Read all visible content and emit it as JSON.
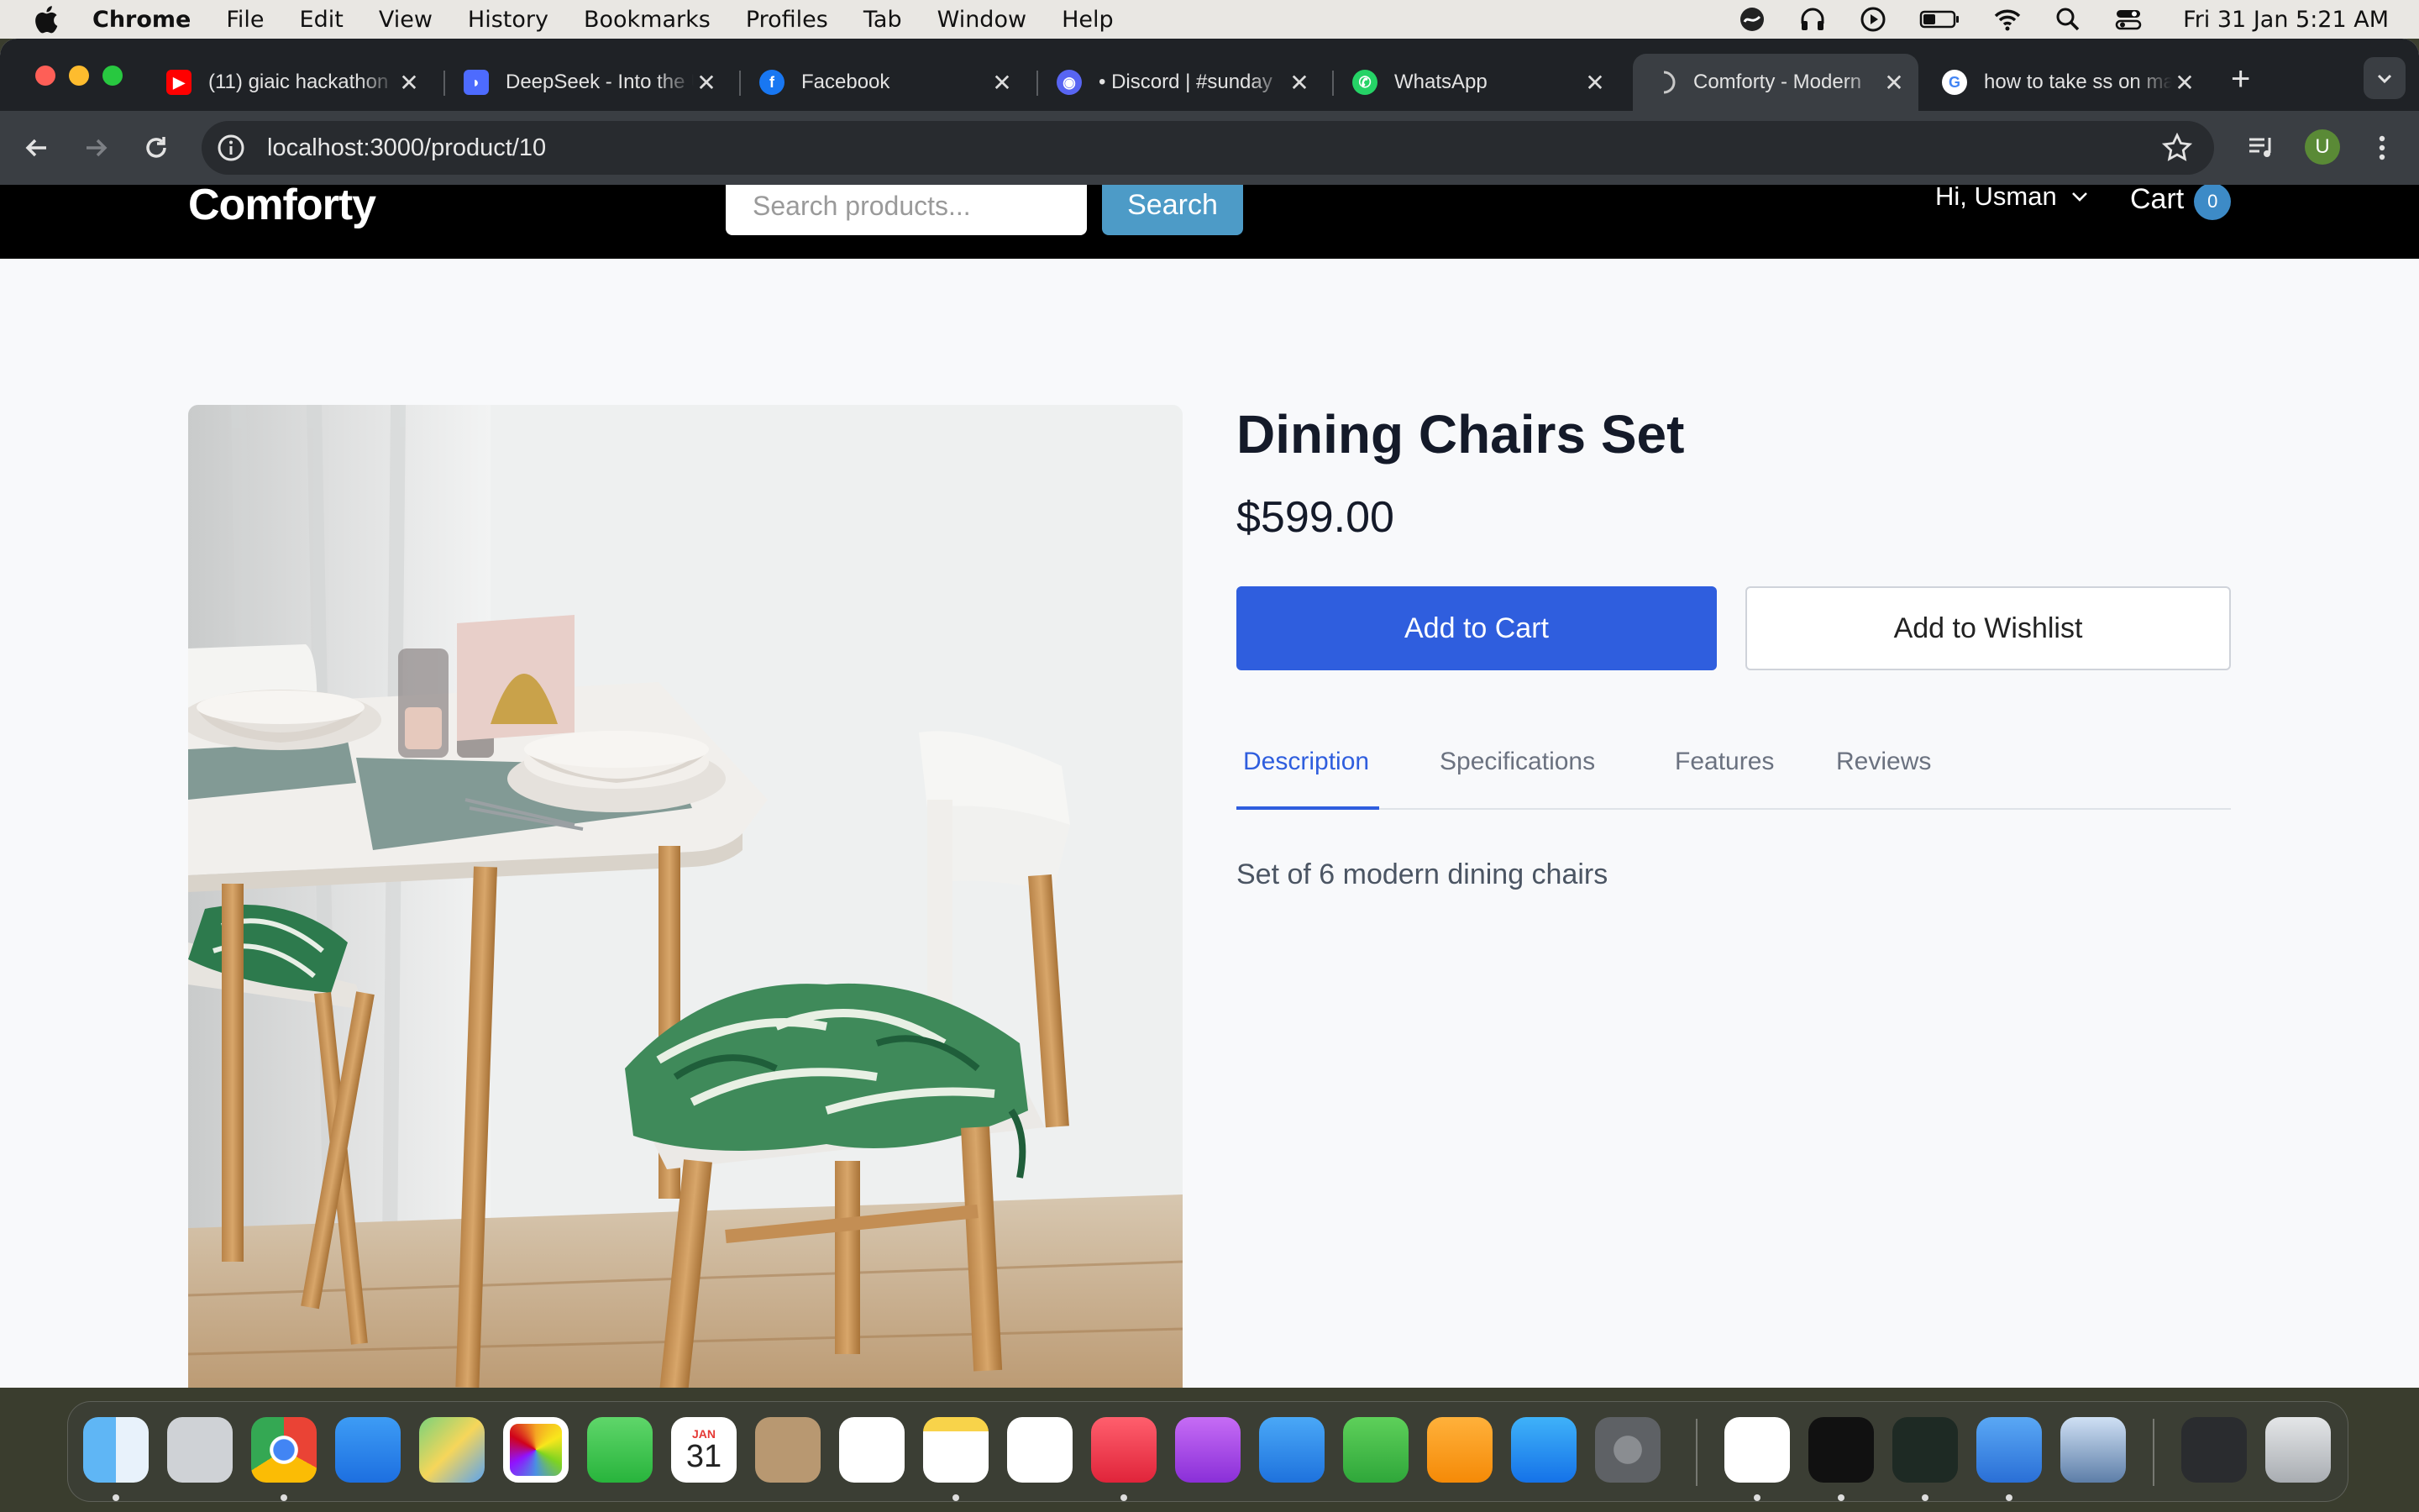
{
  "menubar": {
    "app_name": "Chrome",
    "items": [
      "File",
      "Edit",
      "View",
      "History",
      "Bookmarks",
      "Profiles",
      "Tab",
      "Window",
      "Help"
    ],
    "clock": "Fri 31 Jan  5:21 AM"
  },
  "browser": {
    "tabs": [
      {
        "title": "(11) giaic hackathon",
        "icon": "youtube-icon"
      },
      {
        "title": "DeepSeek - Into the Unknown",
        "icon": "deepseek-icon"
      },
      {
        "title": "Facebook",
        "icon": "facebook-icon"
      },
      {
        "title": "• Discord | #sunday",
        "icon": "discord-icon"
      },
      {
        "title": "WhatsApp",
        "icon": "whatsapp-icon"
      },
      {
        "title": "Comforty - Modern",
        "icon": "loading-icon"
      },
      {
        "title": "how to take ss on mac",
        "icon": "google-icon"
      }
    ],
    "active_tab": 5,
    "url": "localhost:3000/product/10",
    "profile_initial": "U"
  },
  "site": {
    "logo": "Comforty",
    "search_placeholder": "Search products...",
    "search_button": "Search",
    "user_greeting": "Hi, Usman",
    "cart_label": "Cart",
    "cart_count": "0"
  },
  "product": {
    "title": "Dining Chairs Set",
    "price": "$599.00",
    "add_to_cart": "Add to Cart",
    "add_to_wishlist": "Add to Wishlist",
    "tabs": [
      "Description",
      "Specifications",
      "Features",
      "Reviews"
    ],
    "active_tab": "Description",
    "description": "Set of 6 modern dining chairs"
  },
  "dock": {
    "calendar_month": "JAN",
    "calendar_day": "31"
  }
}
